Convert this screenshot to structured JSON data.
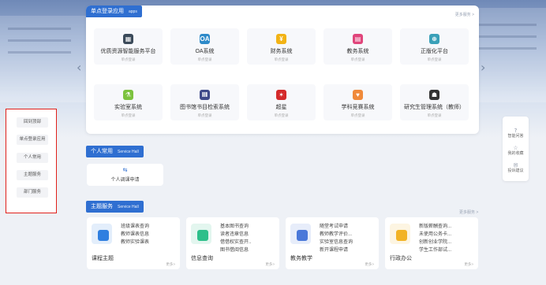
{
  "sso": {
    "title": "单点登录应用",
    "title_en": "apps",
    "more": "更多服务 >",
    "apps": [
      {
        "name": "优质资源智能服务平台",
        "sub": "单点登录",
        "icon": "resource-platform-icon",
        "color": "#3b4a5a",
        "glyph": "▦"
      },
      {
        "name": "OA系统",
        "sub": "单点登录",
        "icon": "oa-icon",
        "color": "#2e8ac9",
        "glyph": "OA"
      },
      {
        "name": "财务系统",
        "sub": "单点登录",
        "icon": "finance-icon",
        "color": "#f2b315",
        "glyph": "¥"
      },
      {
        "name": "教务系统",
        "sub": "单点登录",
        "icon": "academic-icon",
        "color": "#e0457b",
        "glyph": "▤"
      },
      {
        "name": "正版化平台",
        "sub": "单点登录",
        "icon": "license-icon",
        "color": "#3aa0b8",
        "glyph": "⊕"
      },
      {
        "name": "实验室系统",
        "sub": "单点登录",
        "icon": "lab-icon",
        "color": "#7cc23e",
        "glyph": "⚗"
      },
      {
        "name": "图书馆书目检索系统",
        "sub": "单点登录",
        "icon": "library-icon",
        "color": "#3f4a8a",
        "glyph": "Ⅲ"
      },
      {
        "name": "超星",
        "sub": "单点登录",
        "icon": "chaoxing-icon",
        "color": "#d42a2a",
        "glyph": "✶"
      },
      {
        "name": "学科竞赛系统",
        "sub": "单点登录",
        "icon": "competition-icon",
        "color": "#f08a3a",
        "glyph": "♥"
      },
      {
        "name": "研究生管理系统（教师）",
        "sub": "单点登录",
        "icon": "graduate-icon",
        "color": "#333333",
        "glyph": "☗"
      }
    ]
  },
  "left_menu": {
    "items": [
      "回到顶部",
      "单点登录应用",
      "个人常用",
      "主题服务",
      "部门服务"
    ]
  },
  "right_tools": [
    {
      "label": "智能问答",
      "icon": "question-icon",
      "glyph": "?"
    },
    {
      "label": "我的收藏",
      "icon": "star-icon",
      "glyph": "☆"
    },
    {
      "label": "投诉建议",
      "icon": "feedback-icon",
      "glyph": "✉"
    }
  ],
  "personal": {
    "title": "个人常用",
    "title_en": "Service Hall",
    "item": {
      "name": "个人调课申请",
      "icon": "swap-icon",
      "glyph": "⇆"
    }
  },
  "theme": {
    "title": "主题服务",
    "title_en": "Service Hall",
    "more": "更多服务 >",
    "cards": [
      {
        "title": "课程主题",
        "links": [
          "班级课表查询",
          "教师课表信息",
          "教师实验课表"
        ],
        "more": "更多>",
        "color": "#2f7fe0"
      },
      {
        "title": "信息查询",
        "links": [
          "基本图书查询",
          "读者违章信息",
          "借借权实查开..",
          "图书借阅信息"
        ],
        "more": "更多>",
        "color": "#2dbf8a"
      },
      {
        "title": "教务教学",
        "links": [
          "随堂考试申请",
          "教师教学评价...",
          "实验室信息查询",
          "新开课程申请"
        ],
        "more": "更多>",
        "color": "#4a78d9"
      },
      {
        "title": "行政办公",
        "links": [
          "新版薪酬查询...",
          "未使用公务卡...",
          "创新创业学院...",
          "学生工作部试..."
        ],
        "more": "更多>",
        "color": "#f2b325"
      }
    ]
  },
  "colors": {
    "accent": "#2f6fd1",
    "highlight_border": "#e0201a"
  }
}
